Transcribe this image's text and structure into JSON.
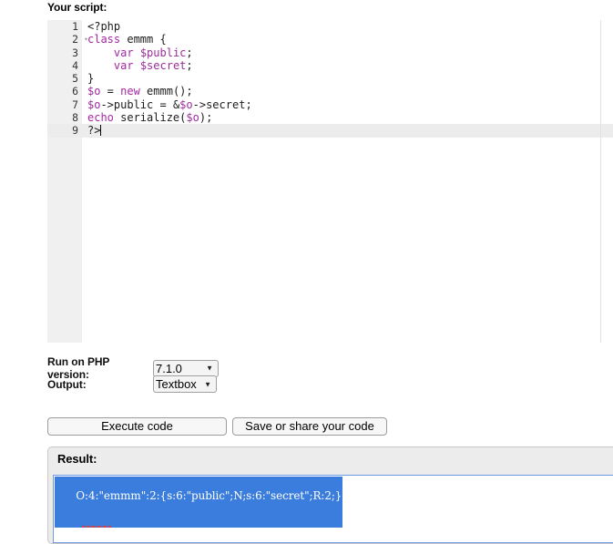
{
  "script_section": {
    "label": "Your script:"
  },
  "editor": {
    "language": "php",
    "active_line": 9,
    "fold_line": 2,
    "lines": [
      {
        "num": "1",
        "text": "<?php"
      },
      {
        "num": "2",
        "text": "class emmm {"
      },
      {
        "num": "3",
        "text": "    var $public;"
      },
      {
        "num": "4",
        "text": "    var $secret;"
      },
      {
        "num": "5",
        "text": "}"
      },
      {
        "num": "6",
        "text": "$o = new emmm();"
      },
      {
        "num": "7",
        "text": "$o->public = &$o->secret;"
      },
      {
        "num": "8",
        "text": "echo serialize($o);"
      },
      {
        "num": "9",
        "text": "?>"
      }
    ],
    "fold_arrow_glyph": "▾"
  },
  "options": {
    "version_label": "Run on PHP version:",
    "version_value": "7.1.0",
    "version_options": [
      "7.1.0"
    ],
    "output_label": "Output:",
    "output_value": "Textbox",
    "output_options": [
      "Textbox"
    ],
    "dropdown_arrow_glyph": "▼"
  },
  "buttons": {
    "execute_label": "Execute code",
    "save_label": "Save or share your code"
  },
  "result": {
    "label": "Result:",
    "value": "O:4:\"emmm\":2:{s:6:\"public\";N;s:6:\"secret\";R:2;}",
    "selected": true
  },
  "colors": {
    "keyword": "#a626a4",
    "variable": "#9b2d9b",
    "selection_bg": "#3b7ddd",
    "selection_fg": "#ffffff",
    "gutter_bg": "#f0f0f0",
    "active_line_bg": "#ececec",
    "textarea_border": "#6f9ae8",
    "spellcheck_underline": "#e03a3a"
  }
}
